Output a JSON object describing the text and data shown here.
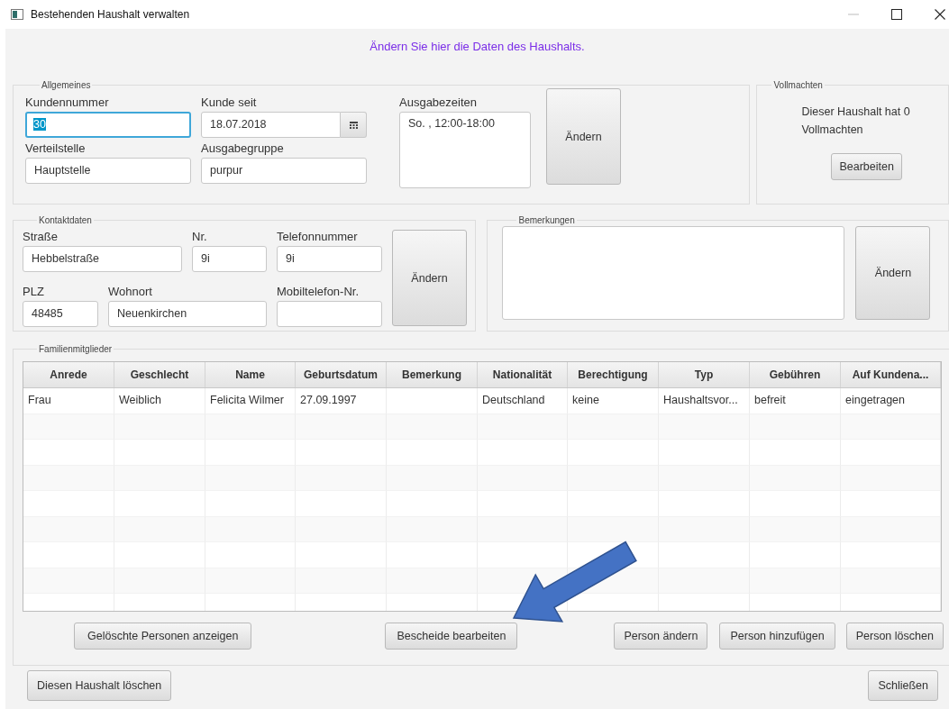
{
  "window": {
    "title": "Bestehenden Haushalt verwalten"
  },
  "message": "Ändern Sie hier die Daten des Haushalts.",
  "general": {
    "title": "Allgemeines",
    "fields": [
      {
        "label": "Kundennummer",
        "value": "30",
        "kind": "text",
        "focused": true
      },
      {
        "label": "Kunde seit",
        "value": "18.07.2018",
        "kind": "date",
        "focused": false
      },
      {
        "label": "Verteilstelle",
        "value": "Hauptstelle",
        "kind": "text",
        "focused": false
      },
      {
        "label": "Ausgabegruppe",
        "value": "purpur",
        "kind": "text",
        "focused": false
      }
    ],
    "times": {
      "label": "Ausgabezeiten",
      "items": [
        "So. , 12:00-18:00"
      ]
    },
    "button": "Ändern"
  },
  "authorizations": {
    "title": "Vollmachten",
    "text": "Dieser Haushalt hat 0 Vollmachten",
    "button": "Bearbeiten"
  },
  "contact": {
    "title": "Kontaktdaten",
    "fields": [
      {
        "label": "Straße",
        "value": "Hebbelstraße",
        "kind": "text",
        "focused": false
      },
      {
        "label": "Nr.",
        "value": "9i",
        "kind": "text",
        "focused": false
      },
      {
        "label": "Telefonnummer",
        "value": "9i",
        "kind": "text",
        "focused": false
      },
      {
        "label": "PLZ",
        "value": "48485",
        "kind": "text",
        "focused": false
      },
      {
        "label": "Wohnort",
        "value": "Neuenkirchen",
        "kind": "text",
        "focused": false
      },
      {
        "label": "Mobiltelefon-Nr.",
        "kind": "text",
        "focused": false
      }
    ],
    "button": "Ändern"
  },
  "remarks": {
    "title": "Bemerkungen",
    "button": "Ändern"
  },
  "family": {
    "title": "Familienmitglieder",
    "table": {
      "columns": [
        "Anrede",
        "Geschlecht",
        "Name",
        "Geburtsdatum",
        "Bemerkung",
        "Nationalität",
        "Berechtigung",
        "Typ",
        "Gebühren",
        "Auf Kundena..."
      ],
      "rows": [
        [
          "Frau",
          "Weiblich",
          "Felicita Wilmer",
          "27.09.1997",
          null,
          "Deutschland",
          "keine",
          "Haushaltsvor...",
          "befreit",
          "eingetragen"
        ]
      ]
    },
    "buttons": [
      "Gelöschte Personen anzeigen",
      "Bescheide bearbeiten",
      "Person ändern",
      "Person hinzufügen",
      "Person löschen"
    ]
  },
  "footer_buttons": [
    "Diesen Haushalt löschen",
    "Schließen"
  ]
}
